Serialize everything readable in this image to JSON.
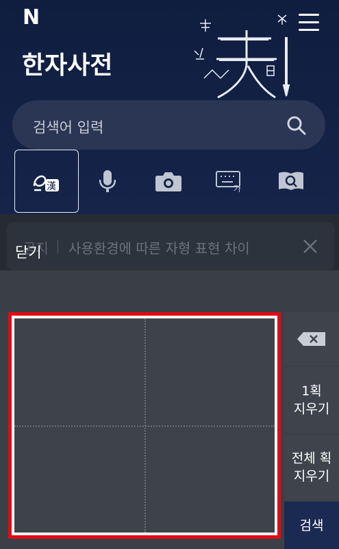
{
  "header": {
    "logo": "N",
    "title": "한자사전"
  },
  "search": {
    "placeholder": "검색어 입력"
  },
  "tools": [
    {
      "name": "handwriting",
      "icon": "handwriting-hanja-icon",
      "active": true
    },
    {
      "name": "voice",
      "icon": "microphone-icon",
      "active": false
    },
    {
      "name": "camera",
      "icon": "camera-icon",
      "active": false
    },
    {
      "name": "keyboard",
      "icon": "keyboard-icon",
      "active": false
    },
    {
      "name": "book",
      "icon": "book-search-icon",
      "active": false
    }
  ],
  "notice": {
    "tag": "공지",
    "text": "사용환경에 따른 자형 표현 차이"
  },
  "panel": {
    "close_label": "닫기",
    "undo_stroke_line1": "1획",
    "undo_stroke_line2": "지우기",
    "clear_all_line1": "전체 획",
    "clear_all_line2": "지우기",
    "search_label": "검색"
  },
  "colors": {
    "header_bg": "#0f1d3f",
    "highlight": "#e50914",
    "search_button_bg": "#1b2a52"
  }
}
